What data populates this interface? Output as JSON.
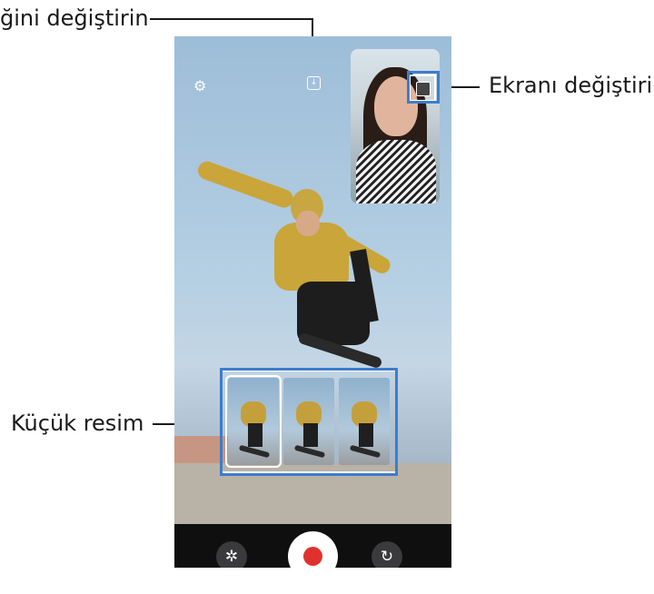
{
  "callouts": {
    "top_left": "ğini değiştirin",
    "right": "Ekranı değiştirin",
    "thumbnail": "Küçük resim"
  },
  "icons": {
    "settings": "gear-icon",
    "mode": "download-box-icon",
    "swap": "swap-screen-icon",
    "effects": "flower-icon",
    "flip": "flip-camera-icon"
  },
  "colors": {
    "record": "#e0322d",
    "highlight": "#3d7dca",
    "control_bar": "#0f0f10"
  },
  "controls": {
    "effects_glyph": "✲",
    "flip_glyph": "↻",
    "gear_glyph": "⚙",
    "mode_glyph": "↓"
  }
}
